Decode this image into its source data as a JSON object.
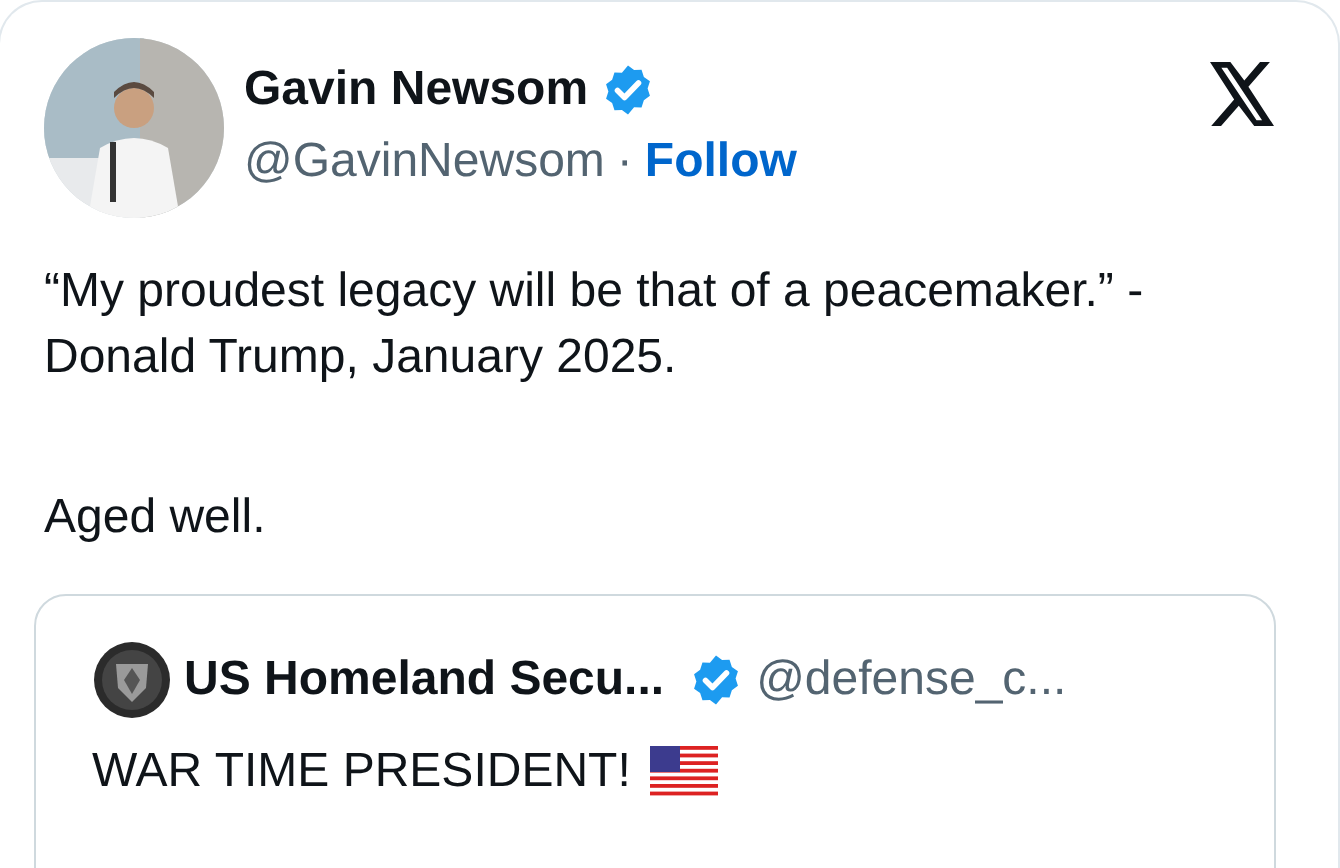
{
  "author": {
    "name": "Gavin Newsom",
    "verified": true,
    "handle": "@GavinNewsom",
    "separator": "·",
    "follow": "Follow"
  },
  "body": [
    "“My proudest legacy will be that of a peacemaker.” - Donald Trump, January 2025.",
    "Aged well."
  ],
  "quote": {
    "name": "US Homeland Secu...",
    "verified": true,
    "handle": "@defense_c...",
    "text": "WAR TIME PRESIDENT!"
  }
}
